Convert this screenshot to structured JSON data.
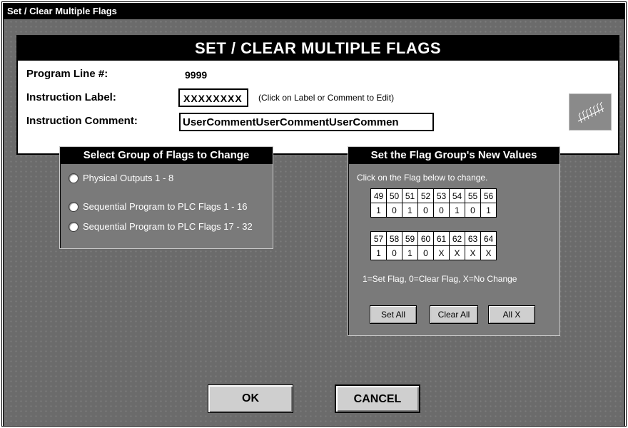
{
  "window": {
    "title": "Set / Clear Multiple Flags"
  },
  "header": {
    "title": "SET / CLEAR MULTIPLE FLAGS",
    "program_line_label": "Program Line #:",
    "program_line_value": "9999",
    "instruction_label_label": "Instruction Label:",
    "instruction_label_value": "XXXXXXXX",
    "edit_hint": "(Click on Label or Comment to Edit)",
    "instruction_comment_label": "Instruction Comment:",
    "instruction_comment_value": "UserCommentUserCommentUserCommen"
  },
  "group_select": {
    "title": "Select Group of Flags to Change",
    "options": [
      {
        "label": "Physical Outputs 1 - 8"
      },
      {
        "label": "Sequential Program to PLC Flags 1 - 16"
      },
      {
        "label": "Sequential Program to PLC Flags 17 - 32"
      }
    ]
  },
  "values_panel": {
    "title": "Set the Flag Group's New Values",
    "instruction": "Click on the Flag below to change.",
    "row1_flags": [
      "49",
      "50",
      "51",
      "52",
      "53",
      "54",
      "55",
      "56"
    ],
    "row1_values": [
      "1",
      "0",
      "1",
      "0",
      "0",
      "1",
      "0",
      "1"
    ],
    "row2_flags": [
      "57",
      "58",
      "59",
      "60",
      "61",
      "62",
      "63",
      "64"
    ],
    "row2_values": [
      "1",
      "0",
      "1",
      "0",
      "X",
      "X",
      "X",
      "X"
    ],
    "legend": "1=Set Flag, 0=Clear Flag, X=No Change",
    "set_all": "Set All",
    "clear_all": "Clear All",
    "all_x": "All X"
  },
  "buttons": {
    "ok": "OK",
    "cancel": "CANCEL"
  }
}
